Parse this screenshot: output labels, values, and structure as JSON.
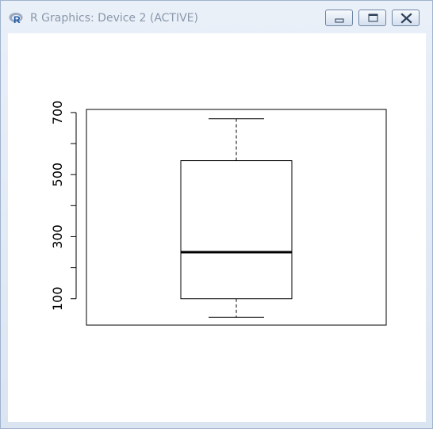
{
  "window": {
    "title": "R Graphics: Device 2 (ACTIVE)",
    "icon": "r-logo-icon",
    "controls": [
      "minimize-icon",
      "restore-icon",
      "close-icon"
    ]
  },
  "chart_data": {
    "type": "boxplot",
    "title": "",
    "xlabel": "",
    "ylabel": "",
    "ylim": [
      15,
      710
    ],
    "y_ticks": [
      100,
      200,
      300,
      400,
      500,
      600,
      700
    ],
    "y_tick_labels": [
      "100",
      "300",
      "500",
      "700"
    ],
    "box": {
      "whisker_low": 40,
      "q1": 100,
      "median": 250,
      "q3": 545,
      "whisker_high": 680
    },
    "grid": false,
    "legend": "none",
    "colors": {
      "box": "#000000",
      "background": "#ffffff"
    }
  }
}
